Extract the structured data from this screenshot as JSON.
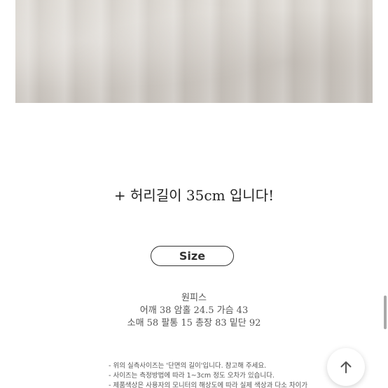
{
  "product_image": {
    "alt": ""
  },
  "waist_note": "+ 허리길이 35cm 입니다!",
  "size_button": {
    "label": "Size"
  },
  "measurements": {
    "item_type": "원피스",
    "line1": "어깨 38  암홀 24.5  가슴 43",
    "line2": "소매 58 팔통 15 총장 83 밑단 92"
  },
  "notes": {
    "line1": "- 위의 실측사이즈는 '단면의 길이'입니다. 참고해 주세요.",
    "line2": "- 사이즈는 측정방법에 따라 1~3cm 정도 오차가 있습니다.",
    "line3": "- 제품색상은 사용자의 모니터의 해상도에 따라 실제 색상과 다소 차이가"
  },
  "icons": {
    "scroll_top": "arrow-up-icon"
  },
  "colors": {
    "text": "#222222",
    "muted_text": "#555555",
    "photo_tone": "#d7d2cc"
  }
}
